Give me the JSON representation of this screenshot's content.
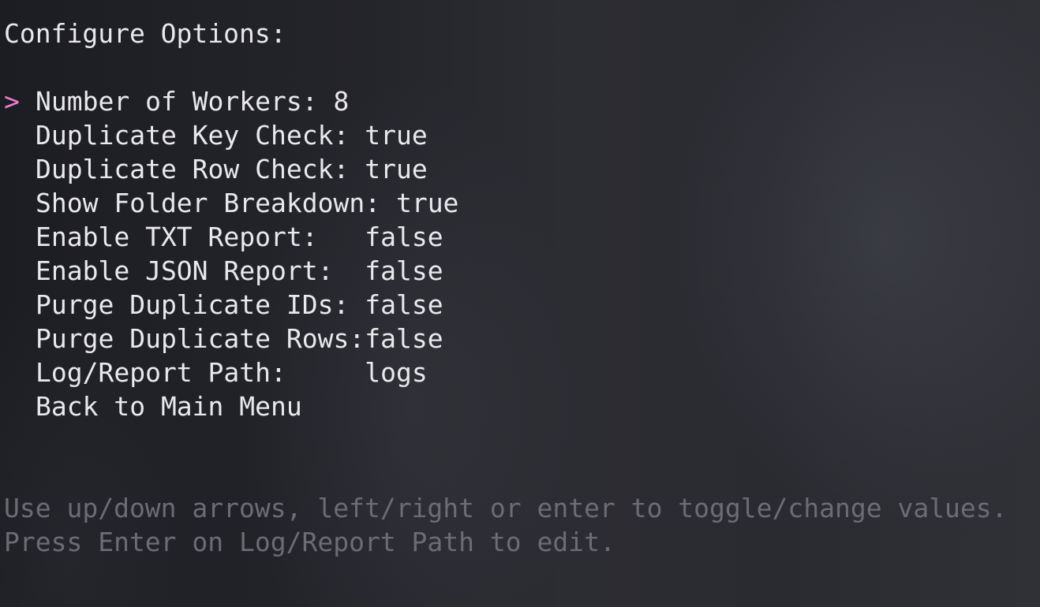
{
  "title": "Configure Options:",
  "pointer": ">",
  "items": [
    {
      "label": "Number of Workers: 8"
    },
    {
      "label": "Duplicate Key Check: true"
    },
    {
      "label": "Duplicate Row Check: true"
    },
    {
      "label": "Show Folder Breakdown: true"
    },
    {
      "label": "Enable TXT Report:   false"
    },
    {
      "label": "Enable JSON Report:  false"
    },
    {
      "label": "Purge Duplicate IDs: false"
    },
    {
      "label": "Purge Duplicate Rows:false"
    },
    {
      "label": "Log/Report Path:     logs"
    },
    {
      "label": "Back to Main Menu"
    }
  ],
  "hints": [
    "Use up/down arrows, left/right or enter to toggle/change values.",
    "Press Enter on Log/Report Path to edit."
  ],
  "colors": {
    "pointer": "#f07ccf",
    "text": "#e9e9ec",
    "hint": "#6c6d74"
  }
}
